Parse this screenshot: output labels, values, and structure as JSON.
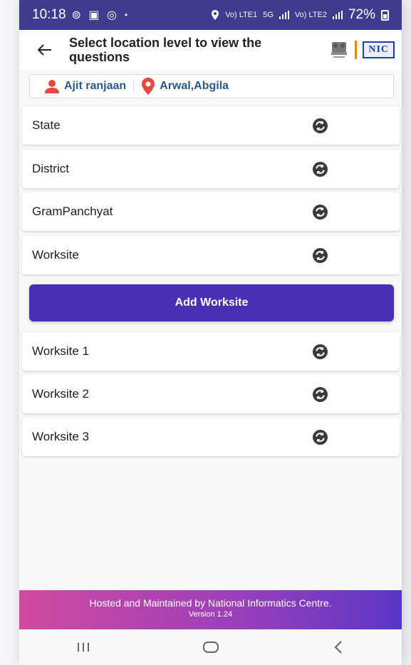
{
  "status": {
    "time": "10:18",
    "icons": "⊚ ▣ ◎",
    "dot": "•",
    "net_left": "Vo) LTE1",
    "net_5g": "5G",
    "net_right": "Vo) LTE2",
    "battery": "72%"
  },
  "appbar": {
    "back_icon": "arrow-left-icon",
    "title": "Select location level to view the questions",
    "nic_logo": "NIC",
    "emblem_icon": "national-emblem-icon"
  },
  "user": {
    "name": "Ajit ranjaan",
    "location": "Arwal,Abgila",
    "name_icon": "person-icon",
    "location_icon": "location-pin-icon",
    "icon_color": "#e8473f"
  },
  "levels": [
    {
      "label": "State"
    },
    {
      "label": "District"
    },
    {
      "label": "GramPanchyat"
    },
    {
      "label": "Worksite"
    }
  ],
  "add_worksite_label": "Add Worksite",
  "worksites": [
    {
      "label": "Worksite 1"
    },
    {
      "label": "Worksite 2"
    },
    {
      "label": "Worksite 3"
    }
  ],
  "footer": {
    "line1": "Hosted and Maintained by National Informatics Centre.",
    "line2": "Version 1.24"
  },
  "colors": {
    "primary": "#4a2fb4",
    "statusbar": "#3f3c8f",
    "link_text": "#2b5a8c"
  }
}
